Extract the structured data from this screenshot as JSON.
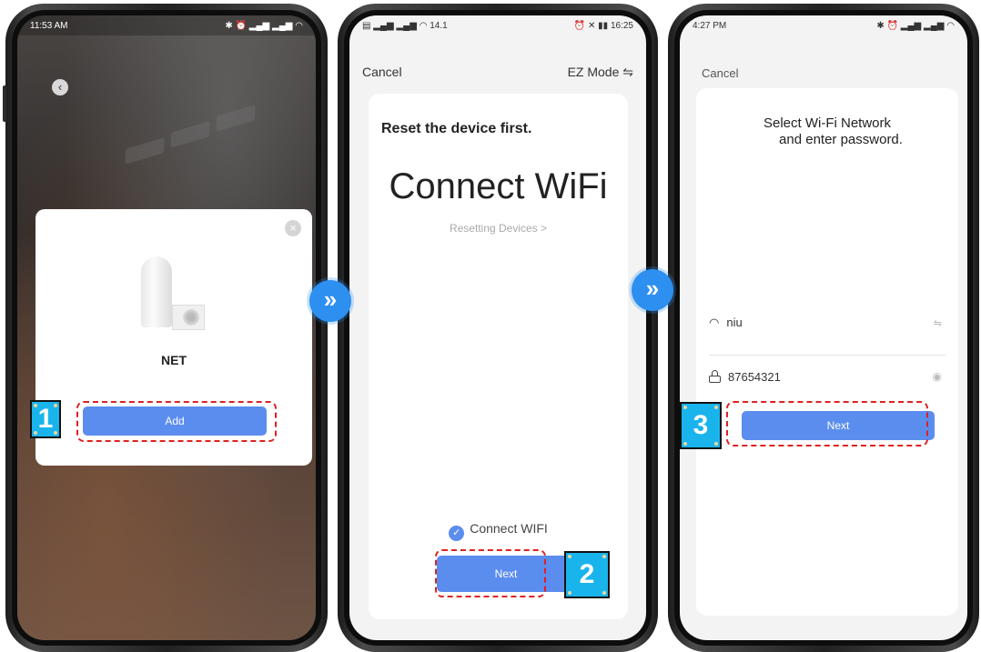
{
  "phone1": {
    "time": "11:53 AM",
    "status_icons": "✱ ⏰ ▂▄▆ ▂▄▆ ◠",
    "modal": {
      "device_name": "NET",
      "add_label": "Add"
    },
    "step_number": "1"
  },
  "phone2": {
    "status_left": "▤ ▂▄▆ ▂▄▆ ◠ 14.1",
    "status_right": "⏰ ✕ ▮▮ 16:25",
    "cancel_label": "Cancel",
    "ez_mode_label": "EZ Mode ⇋",
    "reset_title": "Reset the device first.",
    "connect_title": "Connect WiFi",
    "resetting_link": "Resetting Devices >",
    "check_label": "Connect WIFI",
    "next_label": "Next",
    "step_number": "2"
  },
  "phone3": {
    "time": "4:27 PM",
    "status_icons": "✱ ⏰ ▂▄▆ ▂▄▆ ◠",
    "cancel_label": "Cancel",
    "select_title_line1": "Select  Wi-Fi Network",
    "select_title_line2": "and enter password.",
    "wifi_name": "niu",
    "password": "87654321",
    "next_label": "Next",
    "step_number": "3"
  },
  "arrows": {
    "symbol": "»"
  },
  "colors": {
    "accent": "#5b8def",
    "highlight": "#e02020",
    "step_badge": "#1ab4ec"
  }
}
